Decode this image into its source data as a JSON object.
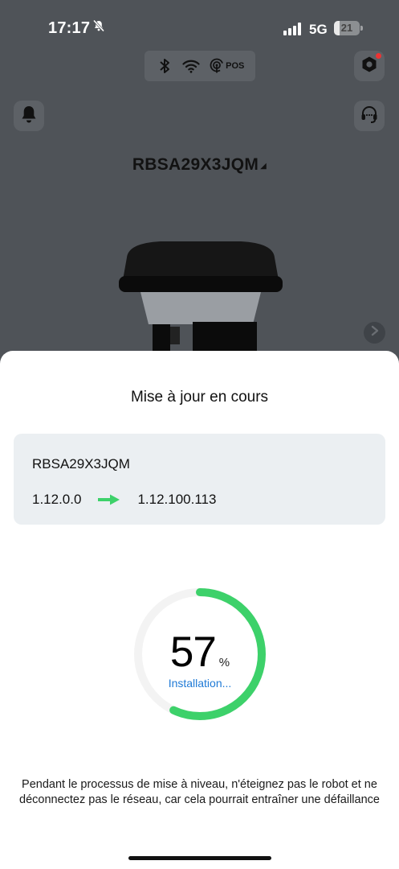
{
  "status_bar": {
    "time": "17:17",
    "network": "5G",
    "battery_level": "21",
    "battery_fraction": 0.21,
    "silent_icon": "bell-slash-icon"
  },
  "connection": {
    "bluetooth_icon": "bluetooth-icon",
    "wifi_icon": "wifi-icon",
    "pos_label": "POS"
  },
  "header": {
    "device_name": "RBSA29X3JQM",
    "caret": "◢"
  },
  "sheet": {
    "title": "Mise à jour en cours",
    "device_name": "RBSA29X3JQM",
    "from_version": "1.12.0.0",
    "to_version": "1.12.100.113",
    "progress_value": "57",
    "progress_fraction": 0.57,
    "progress_unit": "%",
    "progress_status": "Installation...",
    "warning": "Pendant le processus de mise à niveau, n'éteignez pas le robot et ne déconnectez pas le réseau, car cela pourrait entraîner une défaillance"
  },
  "colors": {
    "accent_green": "#3dd16a",
    "status_blue": "#1f7ad6",
    "card_bg": "#ebeff2",
    "overlay": "#4f5358"
  }
}
